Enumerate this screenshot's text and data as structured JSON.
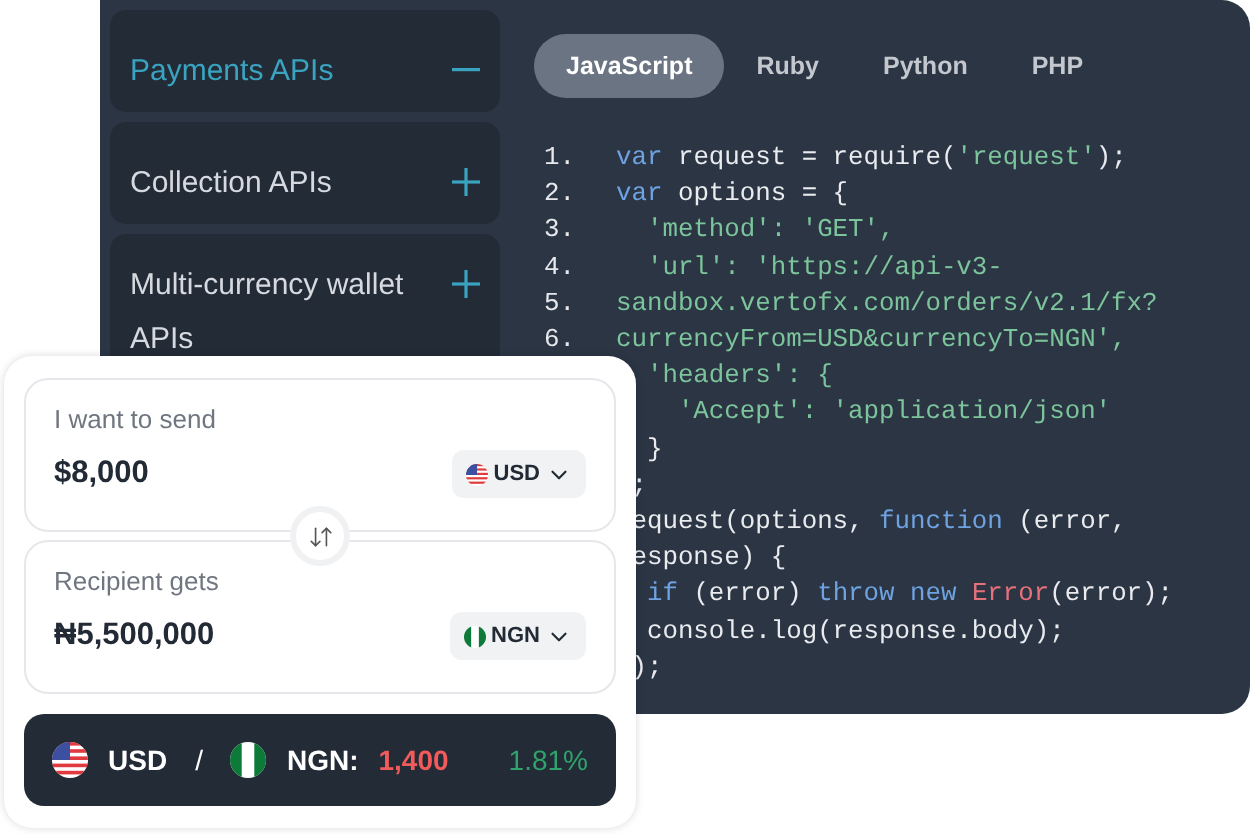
{
  "sidebar": {
    "items": [
      {
        "label": "Payments APIs",
        "expanded": true
      },
      {
        "label": "Collection APIs",
        "expanded": false
      },
      {
        "label": "Multi-currency wallet APIs",
        "expanded": false
      }
    ]
  },
  "tabs": [
    {
      "label": "JavaScript",
      "selected": true
    },
    {
      "label": "Ruby",
      "selected": false
    },
    {
      "label": "Python",
      "selected": false
    },
    {
      "label": "PHP",
      "selected": false
    }
  ],
  "code": [
    {
      "number": "1.",
      "tokens": [
        {
          "kind": "keyword",
          "text": "var"
        },
        {
          "kind": "plain",
          "text": " request = require("
        },
        {
          "kind": "string",
          "text": "'request'"
        },
        {
          "kind": "plain",
          "text": ");"
        }
      ]
    },
    {
      "number": "2.",
      "tokens": [
        {
          "kind": "keyword",
          "text": "var"
        },
        {
          "kind": "plain",
          "text": " options = {"
        }
      ]
    },
    {
      "number": "3.",
      "tokens": [
        {
          "kind": "string",
          "text": "  'method': 'GET',"
        }
      ]
    },
    {
      "number": "4.",
      "tokens": [
        {
          "kind": "string",
          "text": "  'url': 'https://api-v3-"
        }
      ]
    },
    {
      "number": "5.",
      "tokens": [
        {
          "kind": "string",
          "text": "sandbox.vertofx.com/orders/v2.1/fx?"
        }
      ]
    },
    {
      "number": "6.",
      "tokens": [
        {
          "kind": "string",
          "text": "currencyFrom=USD&currencyTo=NGN',"
        }
      ]
    },
    {
      "tokens": [
        {
          "kind": "string",
          "text": "  'headers': {"
        }
      ]
    },
    {
      "tokens": [
        {
          "kind": "string",
          "text": "    'Accept': 'application/json'"
        }
      ]
    },
    {
      "tokens": [
        {
          "kind": "plain",
          "text": "  }"
        }
      ]
    },
    {
      "tokens": [
        {
          "kind": "plain",
          "text": " ;"
        }
      ]
    },
    {
      "tokens": [
        {
          "kind": "plain",
          "text": " equest(options, "
        },
        {
          "kind": "keyword",
          "text": "function"
        },
        {
          "kind": "plain",
          "text": " (error,"
        }
      ]
    },
    {
      "tokens": [
        {
          "kind": "plain",
          "text": " esponse) {"
        }
      ]
    },
    {
      "tokens": [
        {
          "kind": "keyword",
          "text": "  if"
        },
        {
          "kind": "plain",
          "text": " (error) "
        },
        {
          "kind": "keyword",
          "text": "throw new"
        },
        {
          "kind": "error",
          "text": " Error"
        },
        {
          "kind": "plain",
          "text": "(error);"
        }
      ]
    },
    {
      "tokens": [
        {
          "kind": "plain",
          "text": "  console.log(response.body);"
        }
      ]
    },
    {
      "tokens": [
        {
          "kind": "plain",
          "text": " );"
        }
      ]
    }
  ],
  "converter": {
    "fields": [
      {
        "label": "I want to send",
        "amount": "$8,000",
        "currency": "USD",
        "flag": {
          "kind": "us"
        }
      },
      {
        "label": "Recipient gets",
        "amount": "₦5,500,000",
        "currency": "NGN",
        "flag": {
          "kind": "ng"
        }
      }
    ],
    "rate": {
      "base": "USD",
      "base_flag": {
        "kind": "us"
      },
      "separator": "/",
      "quote": "NGN:",
      "quote_flag": {
        "kind": "ng"
      },
      "value": "1,400",
      "change": "1.81%"
    }
  }
}
